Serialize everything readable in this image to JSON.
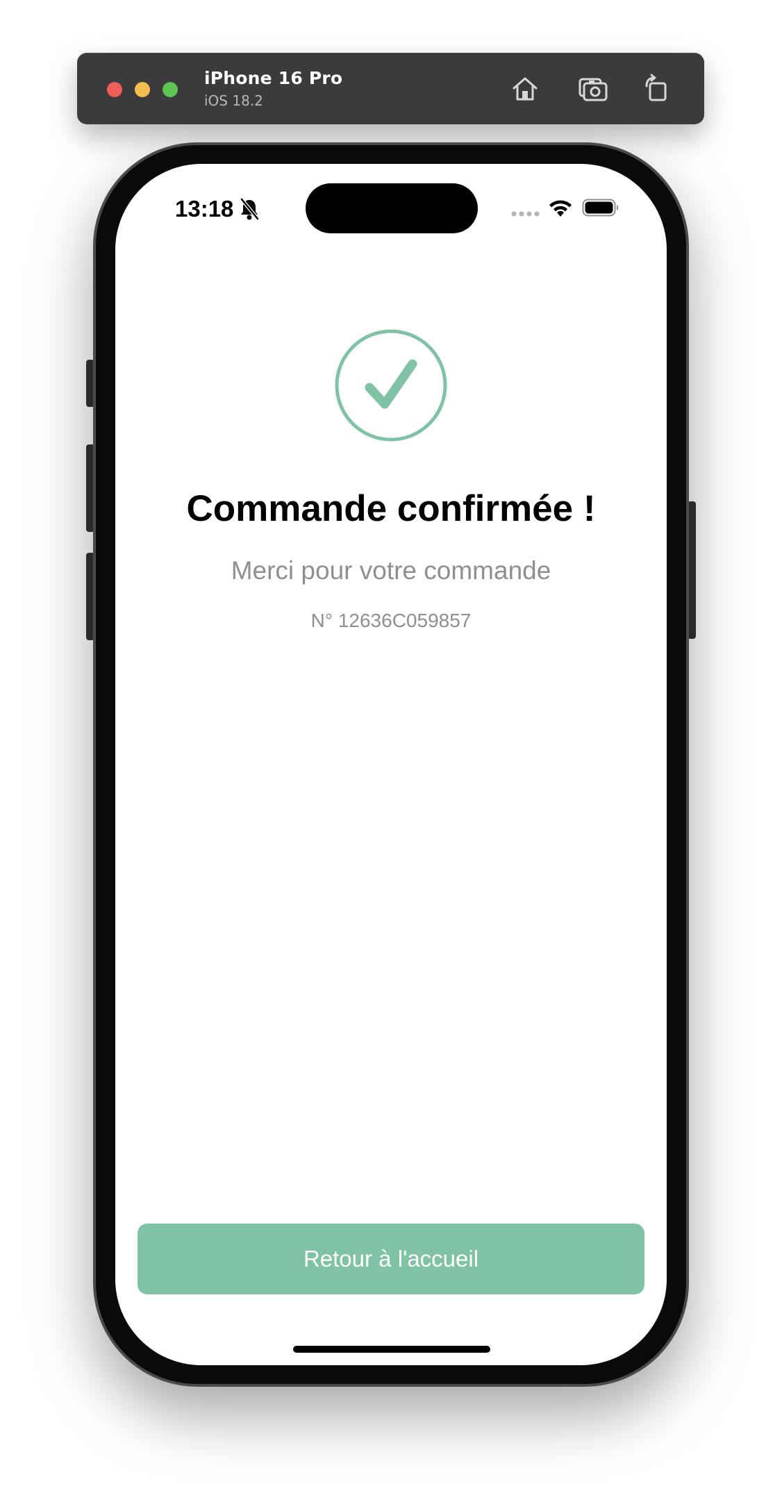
{
  "simulator": {
    "device_name": "iPhone 16 Pro",
    "os_version": "iOS 18.2",
    "toolbar_icons": [
      "home-icon",
      "screenshot-icon",
      "rotate-icon"
    ]
  },
  "status_bar": {
    "time": "13:18",
    "icons": [
      "bell-slash-icon",
      "cellular-icon",
      "wifi-icon",
      "battery-icon"
    ]
  },
  "confirmation": {
    "icon": "checkmark-circle-icon",
    "title": "Commande confirmée !",
    "subtitle": "Merci pour votre commande",
    "order_number": "N° 12636C059857"
  },
  "actions": {
    "home_button_label": "Retour à l'accueil"
  },
  "colors": {
    "accent": "#80c2a5",
    "secondary_text": "#8e8e93",
    "title_text": "#000000",
    "simulator_bar": "#3b3b3d"
  }
}
